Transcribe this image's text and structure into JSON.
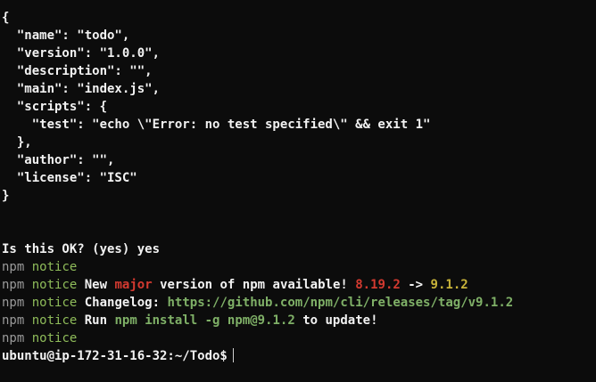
{
  "json_block": [
    "{",
    "  \"name\": \"todo\",",
    "  \"version\": \"1.0.0\",",
    "  \"description\": \"\",",
    "  \"main\": \"index.js\",",
    "  \"scripts\": {",
    "    \"test\": \"echo \\\"Error: no test specified\\\" && exit 1\"",
    "  },",
    "  \"author\": \"\",",
    "  \"license\": \"ISC\"",
    "}"
  ],
  "confirm_line": "Is this OK? (yes) yes",
  "npm": {
    "prefix": "npm",
    "notice": "notice",
    "new_version": {
      "text_new": "New",
      "text_major": "major",
      "text_rest": "version of npm available!",
      "old_version": "8.19.2",
      "arrow": "->",
      "new_version": "9.1.2"
    },
    "changelog": {
      "label": "Changelog:",
      "url": "https://github.com/npm/cli/releases/tag/v9.1.2"
    },
    "run": {
      "text_run": "Run",
      "command": "npm install -g npm@9.1.2",
      "text_rest": "to update!"
    }
  },
  "prompt": "ubuntu@ip-172-31-16-32:~/Todo$",
  "colors": {
    "background": "#0c0c0c",
    "text": "#f2f2f2",
    "npm_gray": "#9a9a9a",
    "notice_green": "#8fbc5a",
    "major_red": "#d33a30",
    "version_yellow": "#c9b43a",
    "link_green": "#7fb067"
  }
}
